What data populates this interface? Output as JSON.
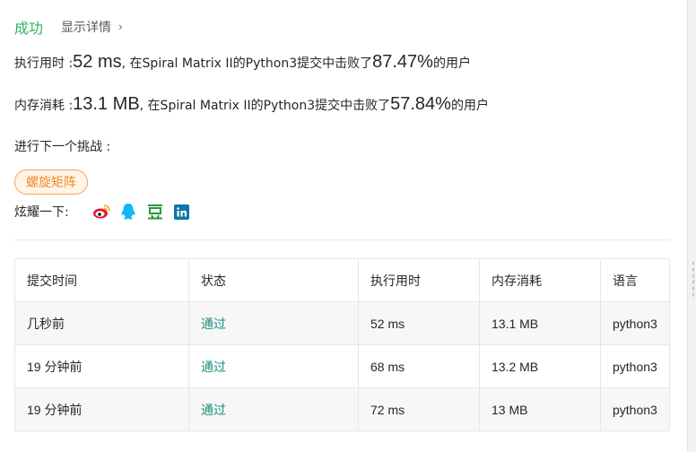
{
  "status": {
    "result": "成功",
    "details_label": "显示详情",
    "chevron": "›"
  },
  "runtime": {
    "label": "执行用时 : ",
    "value": "52 ms",
    "middle": ", 在Spiral Matrix II的Python3提交中击败了",
    "percent": "87.47%",
    "suffix": " 的用户"
  },
  "memory": {
    "label": "内存消耗 : ",
    "value": "13.1 MB",
    "middle": ", 在Spiral Matrix II的Python3提交中击败了",
    "percent": "57.84%",
    "suffix": " 的用户"
  },
  "next_challenge": {
    "label": "进行下一个挑战 :",
    "tag": "螺旋矩阵"
  },
  "share": {
    "label": "炫耀一下:",
    "icons": [
      "weibo-icon",
      "qq-icon",
      "douban-icon",
      "linkedin-icon"
    ],
    "colors": {
      "weibo": "#e6162d",
      "qq": "#12b7f5",
      "douban": "#2e963d",
      "linkedin": "#0e76a8"
    }
  },
  "table": {
    "headers": [
      "提交时间",
      "状态",
      "执行用时",
      "内存消耗",
      "语言"
    ],
    "rows": [
      [
        "几秒前",
        "通过",
        "52 ms",
        "13.1 MB",
        "python3"
      ],
      [
        "19 分钟前",
        "通过",
        "68 ms",
        "13.2 MB",
        "python3"
      ],
      [
        "19 分钟前",
        "通过",
        "72 ms",
        "13 MB",
        "python3"
      ]
    ]
  },
  "colors": {
    "success": "#2db55d",
    "tag_border": "#f5a25d",
    "tag_text": "#ef8a2b",
    "passed": "#1a8f7a"
  }
}
